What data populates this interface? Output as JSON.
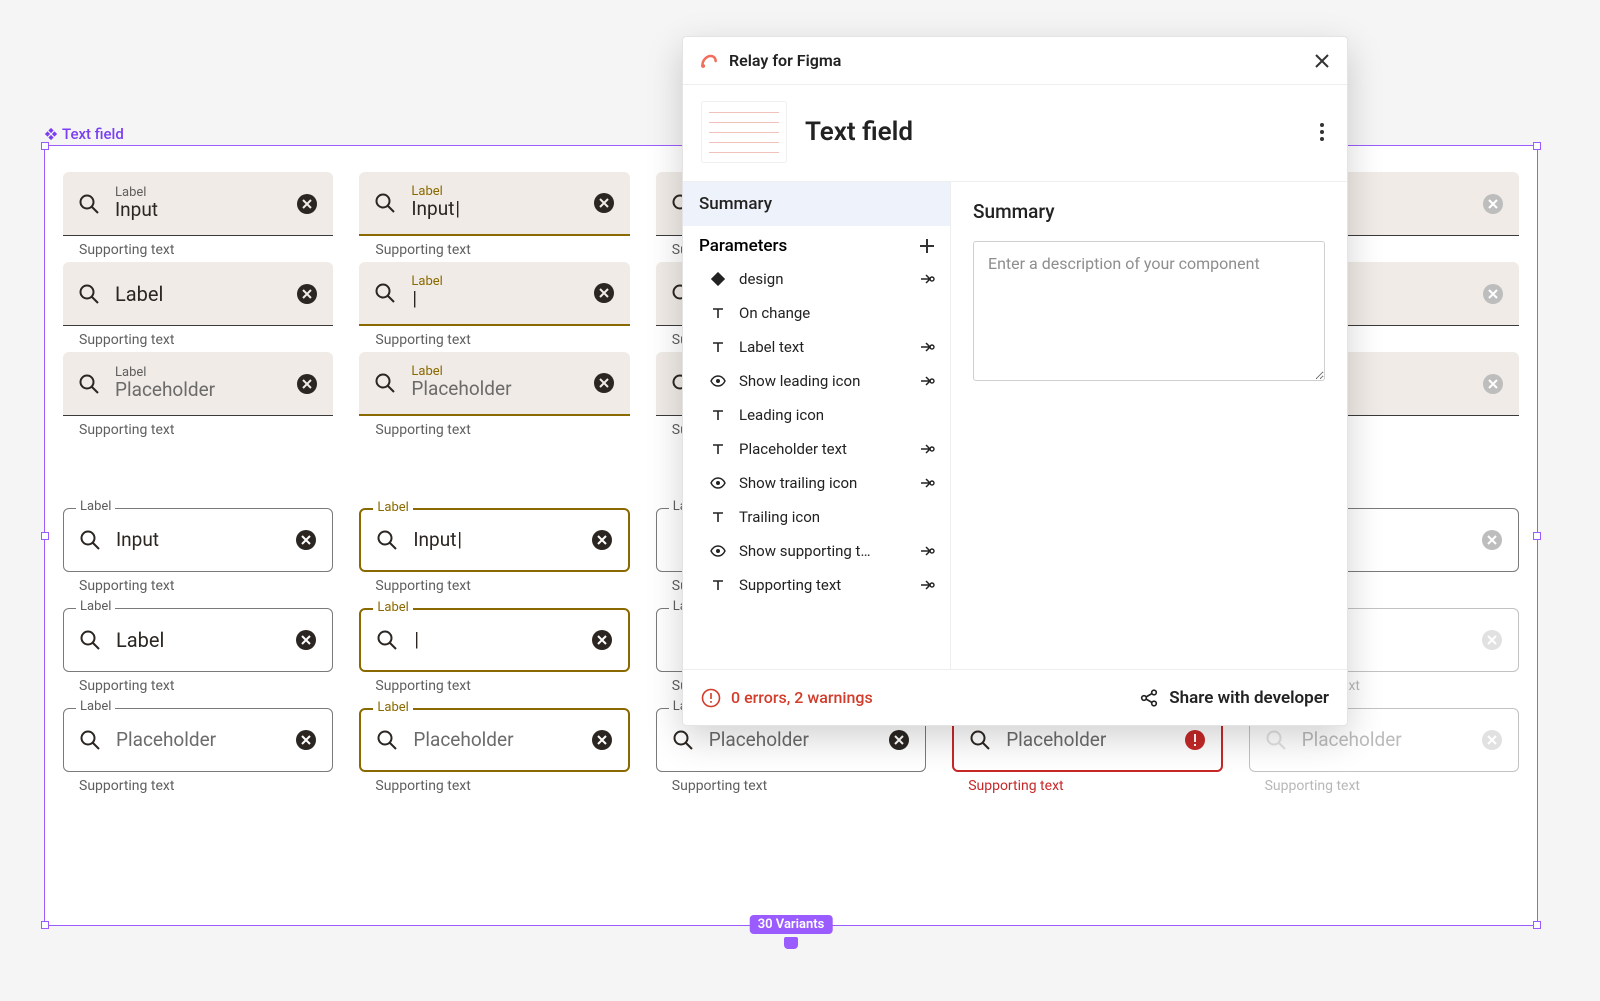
{
  "frame": {
    "label": "Text field",
    "variants_badge": "30 Variants"
  },
  "tf": {
    "label": "Label",
    "input": "Input",
    "placeholder": "Placeholder",
    "supporting": "Supporting text"
  },
  "panel": {
    "title": "Relay for Figma",
    "component_name": "Text field",
    "side": {
      "summary": "Summary",
      "parameters_heading": "Parameters",
      "params": [
        {
          "icon": "diamond",
          "label": "design",
          "interact": true
        },
        {
          "icon": "text",
          "label": "On change",
          "interact": false
        },
        {
          "icon": "text",
          "label": "Label text",
          "interact": true
        },
        {
          "icon": "eye",
          "label": "Show leading icon",
          "interact": true
        },
        {
          "icon": "text",
          "label": "Leading icon",
          "interact": false
        },
        {
          "icon": "text",
          "label": "Placeholder text",
          "interact": true
        },
        {
          "icon": "eye",
          "label": "Show trailing icon",
          "interact": true
        },
        {
          "icon": "text",
          "label": "Trailing icon",
          "interact": false
        },
        {
          "icon": "eye",
          "label": "Show supporting t…",
          "interact": true
        },
        {
          "icon": "text",
          "label": "Supporting text",
          "interact": true
        }
      ]
    },
    "content": {
      "heading": "Summary",
      "placeholder": "Enter a description of your component"
    },
    "footer": {
      "errors": "0 errors, 2 warnings",
      "share": "Share with developer"
    }
  }
}
